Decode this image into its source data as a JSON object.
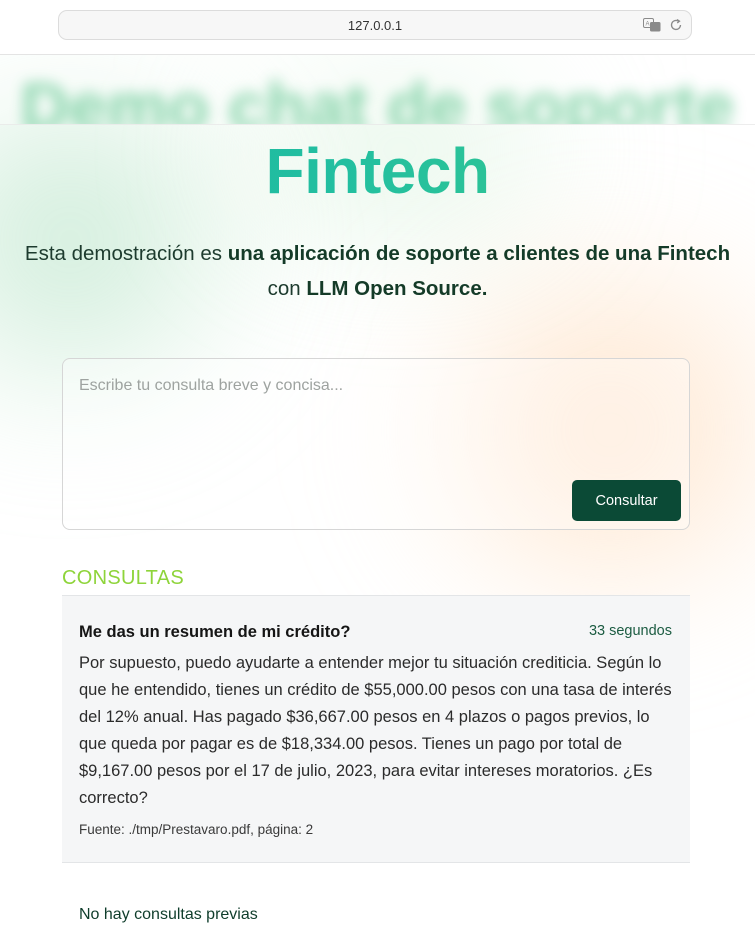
{
  "browser": {
    "url": "127.0.0.1",
    "translate_icon": "translate-icon",
    "reload_icon": "reload-icon"
  },
  "header": {
    "blurred_title": "Demo chat de soporte",
    "title": "Fintech"
  },
  "intro": {
    "part1": "Esta demostración es ",
    "bold1": "una aplicación de soporte a clientes de una Fintech",
    "part2": " con ",
    "bold2": "LLM Open Source."
  },
  "query_form": {
    "placeholder": "Escribe tu consulta breve y concisa...",
    "value": "",
    "submit_label": "Consultar"
  },
  "results": {
    "section_title": "CONSULTAS",
    "items": [
      {
        "question": "Me das un resumen de mi crédito?",
        "time": "33 segundos",
        "answer": "Por supuesto, puedo ayudarte a entender mejor tu situación crediticia. Según lo que he entendido, tienes un crédito de $55,000.00 pesos con una tasa de interés del 12% anual. Has pagado $36,667.00 pesos en 4 plazos o pagos previos, lo que queda por pagar es de $18,334.00 pesos. Tienes un pago por total de $9,167.00 pesos por el 17 de julio, 2023, para evitar intereses moratorios. ¿Es correcto?",
        "source": "Fuente: ./tmp/Prestavaro.pdf, página: 2"
      }
    ]
  },
  "history": {
    "empty_text": "No hay consultas previas"
  },
  "colors": {
    "accent_dark_green": "#0b4a36",
    "title_gradient_start": "#1eb3a3",
    "title_gradient_end": "#3cc98a",
    "section_title_green": "#8ed43a"
  }
}
